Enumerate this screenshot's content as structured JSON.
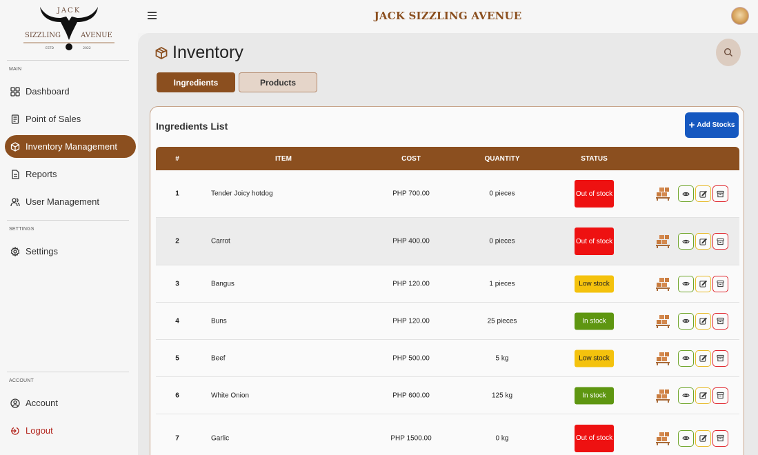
{
  "logo": {
    "top": "JACK",
    "left": "SIZZLING",
    "right": "AVENUE",
    "estd": "ESTD",
    "year": "2022"
  },
  "app_title": "JACK SIZZLING AVENUE",
  "sidebar": {
    "sections": {
      "main": "MAIN",
      "settings": "SETTINGS",
      "account": "ACCOUNT"
    },
    "items": [
      {
        "label": "Dashboard",
        "icon": "dashboard-icon"
      },
      {
        "label": "Point of Sales",
        "icon": "receipt-icon"
      },
      {
        "label": "Inventory Management",
        "icon": "box-icon"
      },
      {
        "label": "Reports",
        "icon": "document-icon"
      },
      {
        "label": "User Management",
        "icon": "users-icon"
      },
      {
        "label": "Settings",
        "icon": "gear-icon"
      },
      {
        "label": "Account",
        "icon": "user-circle-icon"
      },
      {
        "label": "Logout",
        "icon": "logout-icon"
      }
    ],
    "active_index": 2
  },
  "page": {
    "title": "Inventory"
  },
  "tabs": [
    {
      "label": "Ingredients"
    },
    {
      "label": "Products"
    }
  ],
  "card": {
    "title": "Ingredients List",
    "add_button": "Add Stocks"
  },
  "table": {
    "headers": {
      "num": "#",
      "item": "ITEM",
      "cost": "COST",
      "quantity": "QUANTITY",
      "status": "STATUS"
    },
    "rows": [
      {
        "num": "1",
        "item": "Tender Joicy hotdog",
        "cost": "PHP 700.00",
        "quantity": "0 pieces",
        "status": "Out of stock",
        "status_type": "out"
      },
      {
        "num": "2",
        "item": "Carrot",
        "cost": "PHP 400.00",
        "quantity": "0 pieces",
        "status": "Out of stock",
        "status_type": "out"
      },
      {
        "num": "3",
        "item": "Bangus",
        "cost": "PHP 120.00",
        "quantity": "1 pieces",
        "status": "Low stock",
        "status_type": "low"
      },
      {
        "num": "4",
        "item": "Buns",
        "cost": "PHP 120.00",
        "quantity": "25 pieces",
        "status": "In stock",
        "status_type": "in"
      },
      {
        "num": "5",
        "item": "Beef",
        "cost": "PHP 500.00",
        "quantity": "5 kg",
        "status": "Low stock",
        "status_type": "low"
      },
      {
        "num": "6",
        "item": "White Onion",
        "cost": "PHP 600.00",
        "quantity": "125 kg",
        "status": "In stock",
        "status_type": "in"
      },
      {
        "num": "7",
        "item": "Garlic",
        "cost": "PHP 1500.00",
        "quantity": "0 kg",
        "status": "Out of stock",
        "status_type": "out"
      }
    ]
  },
  "colors": {
    "brand": "#8b4f1f",
    "primary_button": "#1558c0",
    "out": "#ee1111",
    "low": "#f4c20d",
    "in": "#5e9611"
  }
}
